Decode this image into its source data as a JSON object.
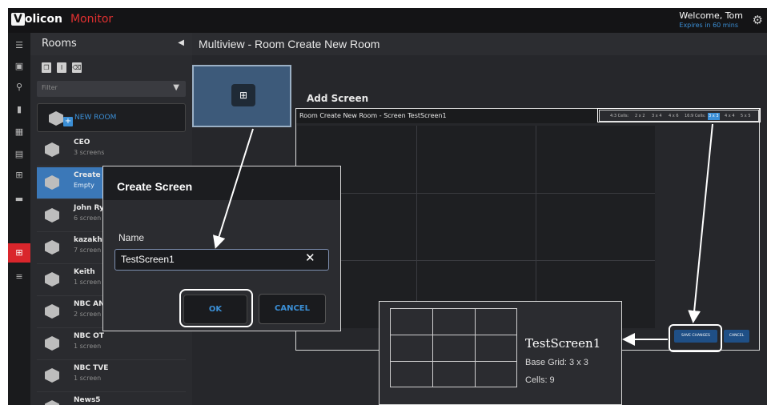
{
  "header": {
    "logo_v": "V",
    "logo_rest": "olicon",
    "app_name": "Monitor",
    "welcome": "Welcome, Tom",
    "expires": "Expires in 60 mins",
    "settings_icon": "gear-icon"
  },
  "rail": {
    "icons": [
      "menu-icon",
      "monitor-icon",
      "search-icon",
      "bookmark-icon",
      "calendar-icon",
      "document-icon",
      "layout-icon",
      "gradient-icon",
      "multiview-icon",
      "list-icon"
    ]
  },
  "rooms": {
    "title": "Rooms",
    "filter_placeholder": "Filter",
    "new_room_label": "NEW ROOM",
    "items": [
      {
        "name": "CEO",
        "sub": "3 screens"
      },
      {
        "name": "Create",
        "sub": "Empty"
      },
      {
        "name": "John Ry",
        "sub": "6 screen"
      },
      {
        "name": "kazakhs",
        "sub": "7 screen"
      },
      {
        "name": "Keith",
        "sub": "1 screen"
      },
      {
        "name": "NBC AN",
        "sub": "2 screen"
      },
      {
        "name": "NBC OT",
        "sub": "1 screen"
      },
      {
        "name": "NBC TVE",
        "sub": "1 screen"
      },
      {
        "name": "News5",
        "sub": ""
      }
    ]
  },
  "main": {
    "title": "Multiview - Room Create New Room",
    "add_screen_label": "Add Screen",
    "screen_panel_title": "Room Create New Room - Screen TestScreen1",
    "grid_selector": {
      "label43": "4:3 Cells:",
      "opt1": "2 x 2",
      "opt2": "3 x 4",
      "opt3": "4 x 6",
      "label169": "16:9 Cells:",
      "opt4": "3 x 3",
      "opt5": "4 x 4",
      "opt6": "5 x 5",
      "selected": "3 x 3"
    },
    "save_label": "SAVE CHANGES",
    "cancel_label": "CANCEL"
  },
  "dialog": {
    "title": "Create Screen",
    "name_label": "Name",
    "name_value": "TestScreen1",
    "ok_label": "OK",
    "cancel_label": "CANCEL"
  },
  "summary": {
    "name": "TestScreen1",
    "base_grid": "Base Grid: 3 x 3",
    "cells": "Cells: 9"
  },
  "colors": {
    "accent": "#3b8fd6",
    "brand_red": "#d9262c",
    "selected_row": "#3b78b8"
  }
}
